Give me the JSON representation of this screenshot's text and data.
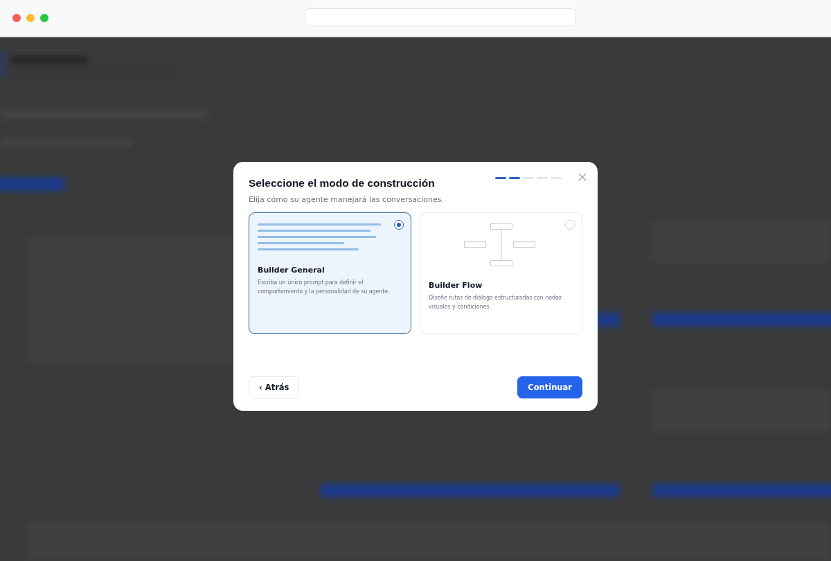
{
  "dialog": {
    "title": "Seleccione el modo de construcción",
    "subtitle": "Elija cómo su agente manejará las conversaciones.",
    "steps": [
      {
        "active": true
      },
      {
        "active": true
      },
      {
        "active": false
      },
      {
        "active": false
      },
      {
        "active": false
      }
    ],
    "options": [
      {
        "kind": "text",
        "title": "Builder General",
        "description": "Escriba un único prompt para definir el comportamiento y la personalidad de su agente.",
        "selected": true
      },
      {
        "kind": "flow",
        "title": "Builder Flow",
        "description": "Diseñe rutas de diálogo estructuradas con nodos visuales y condiciones.",
        "selected": false
      }
    ],
    "back_button": "‹ Atrás",
    "continue_button": "Continuar"
  }
}
